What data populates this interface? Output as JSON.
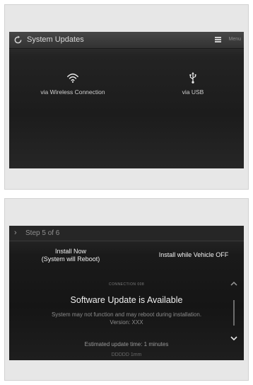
{
  "screen1": {
    "title": "System Updates",
    "menu_label": "Menu",
    "options": [
      {
        "label": "via Wireless Connection",
        "icon": "wifi-icon"
      },
      {
        "label": "via USB",
        "icon": "usb-icon"
      }
    ]
  },
  "screen2": {
    "step_label": "Step 5 of 6",
    "buttons": {
      "install_now_line1": "Install Now",
      "install_now_line2": "(System will Reboot)",
      "install_off": "Install while Vehicle OFF"
    },
    "connection_label": "CONNECTION 008",
    "title": "Software Update is Available",
    "description_line1": "System may not function and may reboot during installation.",
    "description_line2": "Version: XXX",
    "estimated_time": "Estimated update time: 1 minutes",
    "cut_off_text": "DDDDD 1mm"
  },
  "colors": {
    "screen_background": "#1c1c1c",
    "panel_background": "#e7e7e7",
    "text_light": "#f0f0f0"
  }
}
